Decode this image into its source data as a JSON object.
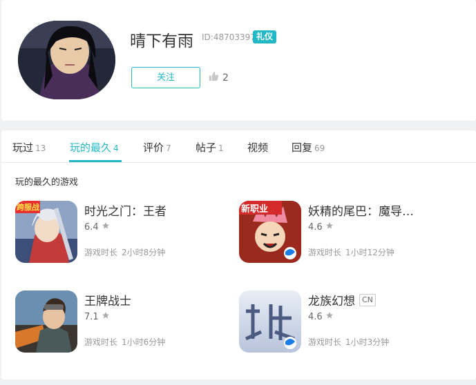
{
  "profile": {
    "username": "晴下有雨",
    "uid": "ID:48703397",
    "badge": "礼仪",
    "follow_label": "关注",
    "likes_count": "2"
  },
  "tabs": [
    {
      "label": "玩过",
      "count": "13"
    },
    {
      "label": "玩的最久",
      "count": "4"
    },
    {
      "label": "评价",
      "count": "7"
    },
    {
      "label": "帖子",
      "count": "1"
    },
    {
      "label": "视频",
      "count": ""
    },
    {
      "label": "回复",
      "count": "69"
    }
  ],
  "active_tab": "玩的最久",
  "section_title": "玩的最久的游戏",
  "playtime_label": "游戏时长",
  "games": [
    {
      "name": "时光之门：王者",
      "rating": "6.4",
      "playtime": "2小时8分钟",
      "icon_badge": "跨服战",
      "tag": ""
    },
    {
      "name": "妖精的尾巴：魔导…",
      "rating": "4.6",
      "playtime": "1小时12分钟",
      "icon_badge": "新职业",
      "tag": ""
    },
    {
      "name": "王牌战士",
      "rating": "7.1",
      "playtime": "1小时6分钟",
      "icon_badge": "",
      "tag": ""
    },
    {
      "name": "龙族幻想",
      "rating": "4.6",
      "playtime": "1小时3分钟",
      "icon_badge": "",
      "tag": "CN"
    }
  ],
  "colors": {
    "accent": "#23b8c6",
    "background": "#f0f1f2",
    "text_muted": "#999999"
  },
  "icons": {
    "like": "thumbs-up-icon",
    "star": "star-icon"
  }
}
